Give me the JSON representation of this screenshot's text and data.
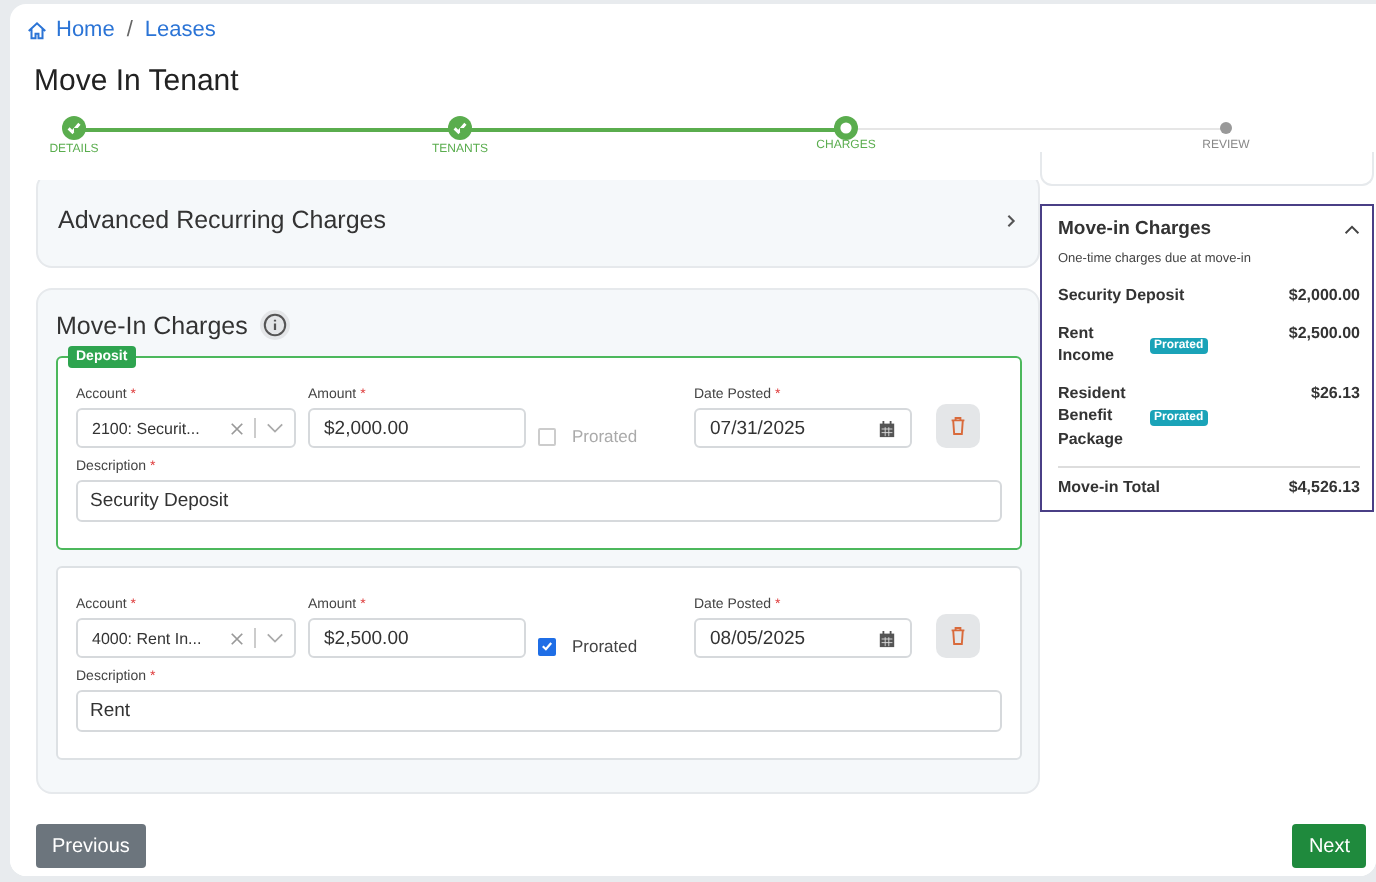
{
  "breadcrumb": [
    {
      "label": "Home",
      "kind": "home"
    },
    {
      "separator": "/",
      "label": "Leases",
      "kind": "link"
    }
  ],
  "title": "Move In Tenant",
  "steps": [
    {
      "label": "DETAILS",
      "completed": true,
      "selected": false
    },
    {
      "label": "TENANTS",
      "completed": true,
      "selected": false
    },
    {
      "label": "CHARGES",
      "completed": false,
      "selected": true
    },
    {
      "label": "REVIEW",
      "completed": false,
      "selected": false
    }
  ],
  "advanced": {
    "title": "Advanced Recurring Charges"
  },
  "charges": {
    "title": "Move-In Charges",
    "items": [
      {
        "badge": "Deposit",
        "highlighted": true,
        "account": {
          "label": "Account",
          "req": "*",
          "value": "2100: Securit..."
        },
        "amount": {
          "label": "Amount",
          "req": "*",
          "value": "$2,000.00"
        },
        "prorated": {
          "label": "Prorated",
          "checked": false
        },
        "date": {
          "label": "Date Posted",
          "req": "*",
          "value": "07/31/2025"
        },
        "description": {
          "label": "Description",
          "req": "*",
          "value": "Security Deposit"
        }
      },
      {
        "highlighted": false,
        "account": {
          "label": "Account",
          "req": "*",
          "value": "4000: Rent In..."
        },
        "amount": {
          "label": "Amount",
          "req": "*",
          "value": "$2,500.00"
        },
        "prorated": {
          "label": "Prorated",
          "checked": true
        },
        "date": {
          "label": "Date Posted",
          "req": "*",
          "value": "08/05/2025"
        },
        "description": {
          "label": "Description",
          "req": "*",
          "value": "Rent"
        }
      }
    ]
  },
  "summary": {
    "title": "Move-in Charges",
    "expanded": true,
    "subtitle": "One-time charges due at move-in",
    "rows": [
      {
        "name": "Security Deposit",
        "amount": "$2,000.00"
      },
      {
        "name": "Rent Income",
        "tag": "Prorated",
        "amount": "$2,500.00"
      },
      {
        "name": "Resident Benefit Package",
        "tag": "Prorated",
        "amount": "$26.13"
      }
    ],
    "total": {
      "name": "Move-in Total",
      "amount": "$4,526.13"
    }
  },
  "footer": {
    "previous": "Previous",
    "next": "Next"
  }
}
